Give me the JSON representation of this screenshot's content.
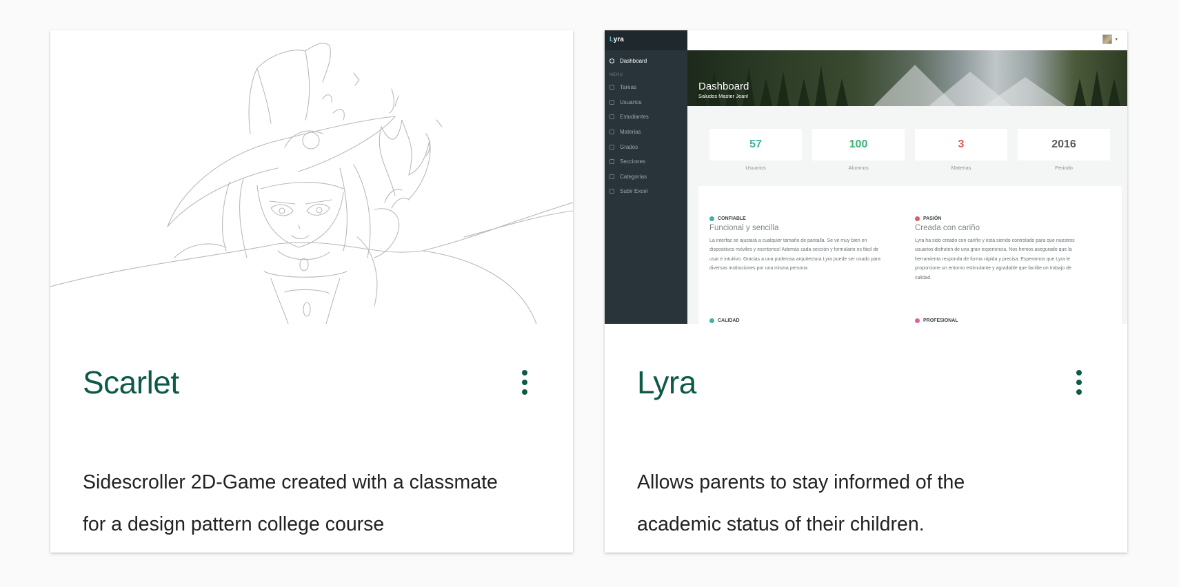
{
  "cards": [
    {
      "title": "Scarlet",
      "description_lines": [
        "Sidescroller 2D-Game created with a classmate",
        "for a design pattern college course"
      ],
      "menu_icon": "more-vert-icon",
      "image": "pencil sketch illustration"
    },
    {
      "title": "Lyra",
      "description_lines": [
        "Allows parents to stay informed of the",
        "academic status of their children."
      ],
      "menu_icon": "more-vert-icon",
      "image": "dashboard screenshot"
    }
  ],
  "lyra_preview": {
    "brand_first": "L",
    "brand_rest": "yra",
    "nav_active": "Dashboard",
    "menu_heading": "MENU",
    "nav_items": [
      "Tareas",
      "Usuarios",
      "Estudiantes",
      "Materias",
      "Grados",
      "Secciones",
      "Categorías",
      "Subir Excel"
    ],
    "banner_title": "Dashboard",
    "banner_subtitle": "Saludos Master Jean!",
    "stats": [
      {
        "value": "57",
        "label": "Usuarios",
        "color": "#3fb2a0"
      },
      {
        "value": "100",
        "label": "Alumnos",
        "color": "#3cb371"
      },
      {
        "value": "3",
        "label": "Materias",
        "color": "#e05b5b"
      },
      {
        "value": "2016",
        "label": "Periodo",
        "color": "#555b5e"
      }
    ],
    "features": [
      {
        "heading": "CONFIABLE",
        "subtitle": "Funcional y sencilla",
        "color": "#3fb2a0",
        "text_lines": [
          "La interfaz se ajustará a cualquier tamaño de pantalla. Se ve muy bien en",
          "dispositivos móviles y escritorios! Además cada sección y formulario es fácil de",
          "usar e intuitivo. Gracias a una poderosa arquitectura Lyra puede ser usado para",
          "diversas instituciones por una misma persona."
        ]
      },
      {
        "heading": "PASIÓN",
        "subtitle": "Creada con cariño",
        "color": "#e05b5b",
        "text_lines": [
          "Lyra ha sido creado con cariño y está siendo controlado para que nuestros",
          "usuarios disfruten de una gran experiencia. Nos hemos asegurado que la",
          "herramienta responda de forma rápida y precisa. Esperamos que Lyra le",
          "proporcione un entorno estimulante y agradable que facilite un trabajo de",
          "calidad."
        ]
      },
      {
        "heading": "CALIDAD",
        "color": "#3fb2a0"
      },
      {
        "heading": "PROFESIONAL",
        "color": "#e0609a"
      }
    ]
  }
}
